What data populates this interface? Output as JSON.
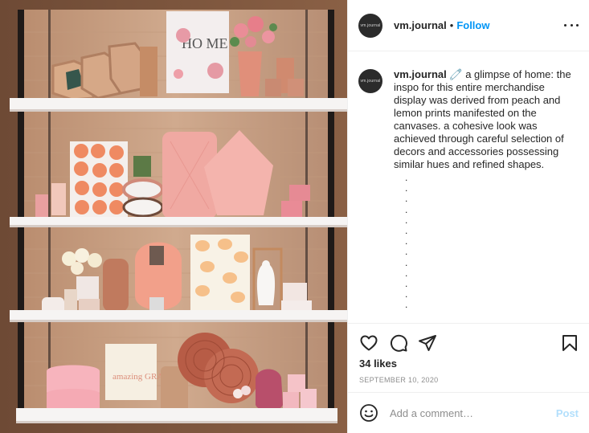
{
  "post": {
    "avatar_text": "vm.journal",
    "username": "vm.journal",
    "separator": "•",
    "follow_label": "Follow",
    "caption_emoji": "🧷",
    "caption_text": "a glimpse of home: the inspo for this entire merchandise display was derived from peach and lemon prints manifested on the canvases. a cohesive look was achieved through careful selection of decors and accessories possessing similar hues and refined shapes.",
    "caption_dots": [
      ".",
      ".",
      ".",
      ".",
      ".",
      ".",
      ".",
      ".",
      ".",
      ".",
      ".",
      ".",
      "."
    ],
    "likes": "34 likes",
    "date": "SEPTEMBER 10, 2020",
    "comment_placeholder": "Add a comment…",
    "post_label": "Post"
  },
  "photo": {
    "canvas_home_text": "HO ME",
    "canvas_grace_text": "amazing GRACE"
  },
  "icons": {
    "more": "more-options-icon",
    "like": "heart-icon",
    "comment": "comment-bubble-icon",
    "share": "paper-plane-icon",
    "save": "bookmark-icon",
    "emoji": "smiley-icon"
  },
  "colors": {
    "accent": "#0095f6",
    "post_disabled": "#b2dffc",
    "muted": "#8e8e8e",
    "text": "#262626"
  }
}
